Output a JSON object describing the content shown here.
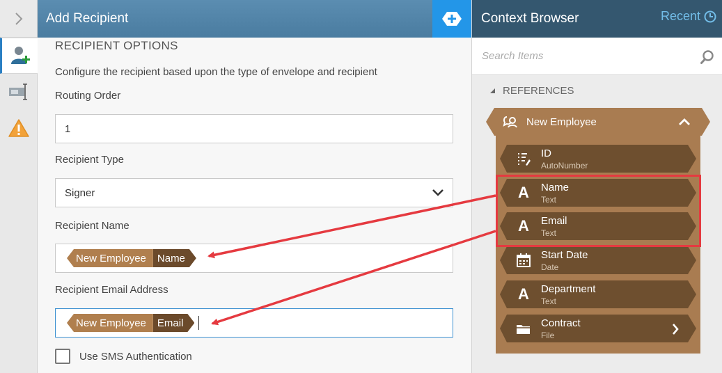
{
  "colors": {
    "panel_header": "#4a7ca0",
    "context_header": "#34576f",
    "add_button": "#2396e8",
    "token_entity": "#b07f4e",
    "token_field": "#6b4a2b",
    "reference_bg": "#a97c51",
    "reference_item": "#6e4f2f",
    "highlight": "#e53a40"
  },
  "rail": {
    "toggle_icon": "chevron-right-icon",
    "items": [
      {
        "icon": "add-recipient-icon",
        "active": true
      },
      {
        "icon": "text-field-icon",
        "active": false
      },
      {
        "icon": "warning-icon",
        "active": false
      }
    ]
  },
  "panel": {
    "title": "Add Recipient",
    "add_icon": "add-icon",
    "section_title": "RECIPIENT OPTIONS",
    "description": "Configure the recipient based upon the type of envelope and recipient",
    "routing_order": {
      "label": "Routing Order",
      "value": "1"
    },
    "recipient_type": {
      "label": "Recipient Type",
      "value": "Signer"
    },
    "recipient_name": {
      "label": "Recipient Name",
      "token_entity": "New Employee",
      "token_field": "Name"
    },
    "recipient_email": {
      "label": "Recipient Email Address",
      "token_entity": "New Employee",
      "token_field": "Email"
    },
    "sms": {
      "label": "Use SMS Authentication",
      "checked": false
    }
  },
  "context": {
    "title": "Context Browser",
    "recent_label": "Recent",
    "search_placeholder": "Search Items",
    "references_label": "REFERENCES",
    "group_name": "New Employee",
    "items": [
      {
        "name": "ID",
        "type": "AutoNumber",
        "icon": "autonumber-icon"
      },
      {
        "name": "Name",
        "type": "Text",
        "icon": "text-icon"
      },
      {
        "name": "Email",
        "type": "Text",
        "icon": "text-icon"
      },
      {
        "name": "Start Date",
        "type": "Date",
        "icon": "calendar-icon"
      },
      {
        "name": "Department",
        "type": "Text",
        "icon": "text-icon"
      },
      {
        "name": "Contract",
        "type": "File",
        "icon": "folder-icon"
      }
    ]
  }
}
